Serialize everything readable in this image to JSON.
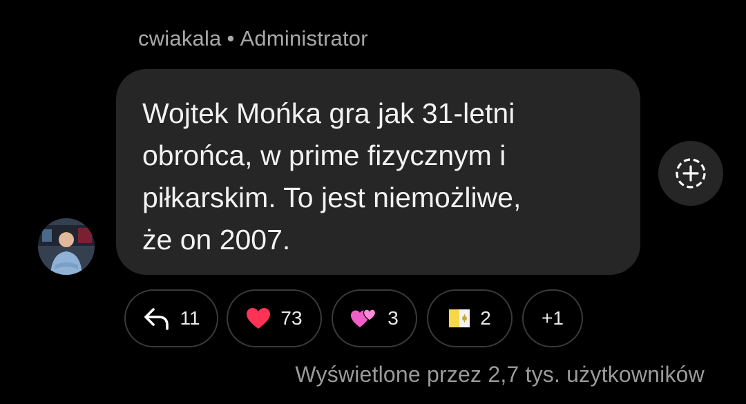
{
  "message": {
    "author": "cwiakala",
    "separator": "•",
    "role": "Administrator",
    "text": "Wojtek Mońka gra jak 31-letni\nobrońca, w prime fizycznym i\npiłkarskim. To jest niemożliwe,\nże on 2007."
  },
  "reactions": {
    "replies": {
      "icon": "reply-arrow-icon",
      "count": "11"
    },
    "items": [
      {
        "icon": "red-heart-emoji",
        "emoji": "❤️",
        "count": "73"
      },
      {
        "icon": "two-hearts-emoji",
        "emoji": "💞",
        "count": "3"
      },
      {
        "icon": "vatican-flag-emoji",
        "emoji": "🇻🇦",
        "count": "2"
      }
    ],
    "more": "+1"
  },
  "add_reaction": {
    "icon": "add-reaction-icon"
  },
  "views_text": "Wyświetlone przez 2,7 tys. użytkowników",
  "colors": {
    "background": "#000000",
    "bubble": "#262626",
    "muted_text": "#a9a9a9",
    "chip_border": "#3a3a3a",
    "heart": "#ff3355"
  }
}
